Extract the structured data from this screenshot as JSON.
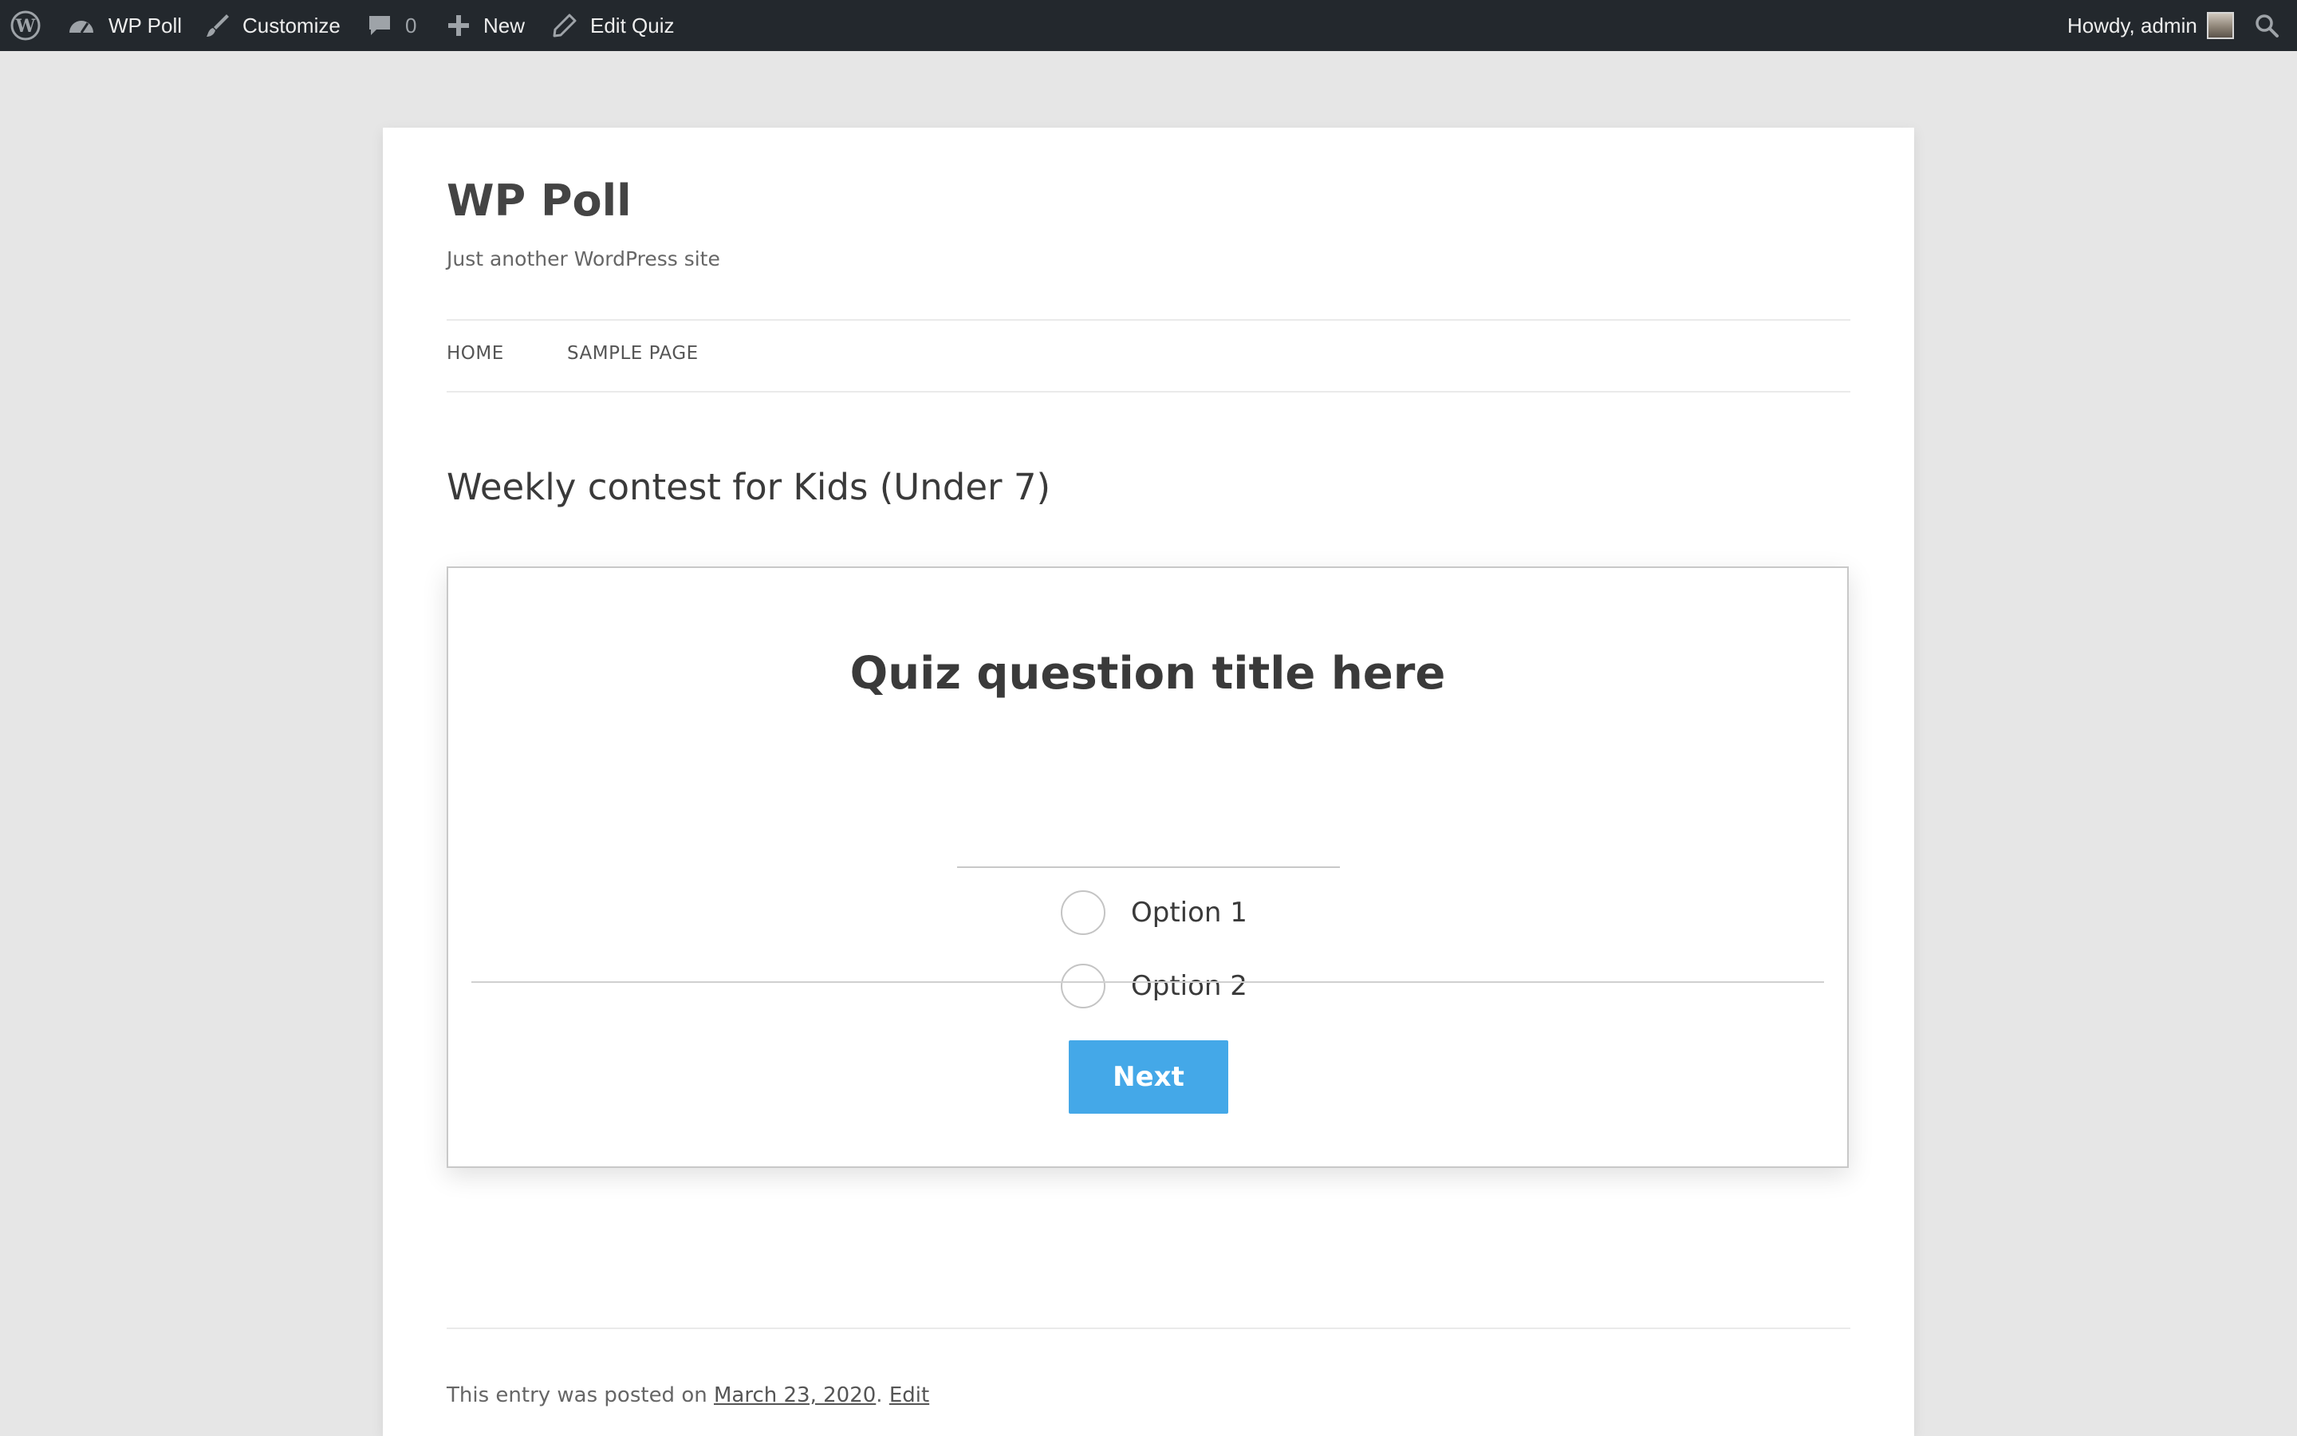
{
  "adminbar": {
    "wp_logo_icon": "wordpress-icon",
    "site_name": "WP Poll",
    "site_icon": "dashboard-icon",
    "customize": "Customize",
    "customize_icon": "paintbrush-icon",
    "comments_icon": "comment-icon",
    "comments_count": "0",
    "new_icon": "plus-icon",
    "new_label": "New",
    "edit_icon": "pencil-icon",
    "edit_label": "Edit Quiz",
    "howdy": "Howdy, admin",
    "search_icon": "search-icon"
  },
  "site": {
    "title": "WP Poll",
    "tagline": "Just another WordPress site"
  },
  "nav": {
    "items": [
      {
        "label": "HOME"
      },
      {
        "label": "SAMPLE PAGE"
      }
    ]
  },
  "entry": {
    "title": "Weekly contest for Kids (Under 7)"
  },
  "quiz": {
    "question_title": "Quiz question title here",
    "options": [
      {
        "label": "Option 1",
        "selected": false
      },
      {
        "label": "Option 2",
        "selected": false
      }
    ],
    "next_label": "Next",
    "button_color": "#44a8e8"
  },
  "footer_meta": {
    "prefix": "This entry was posted on",
    "date": "March 23, 2020",
    "separator": ".",
    "edit": "Edit"
  },
  "colors": {
    "adminbar_bg": "#23282d",
    "page_bg": "#e6e6e6",
    "accent": "#44a8e8"
  }
}
